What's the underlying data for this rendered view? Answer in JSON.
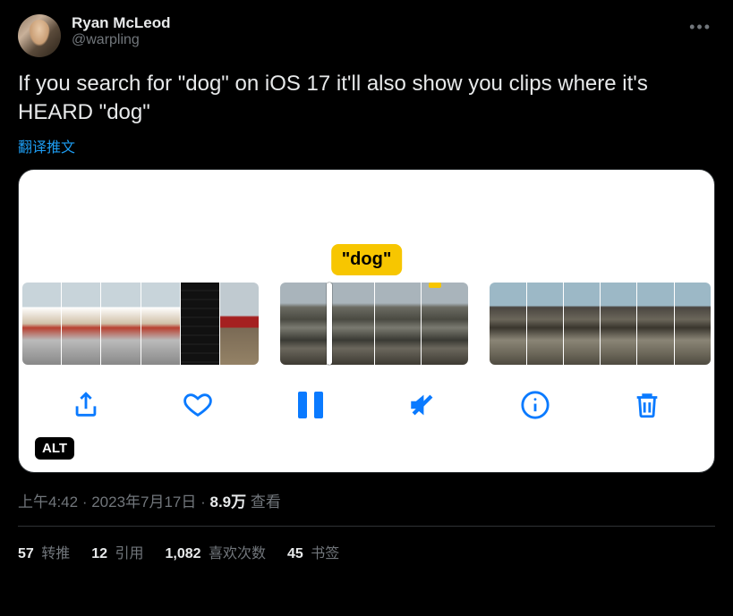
{
  "author": {
    "display_name": "Ryan McLeod",
    "handle": "@warpling"
  },
  "tweet_text": "If you search for \"dog\" on iOS 17 it'll also show you clips where it's HEARD \"dog\"",
  "translate_label": "翻译推文",
  "media": {
    "search_token": "\"dog\"",
    "alt_badge": "ALT",
    "toolbar_icons": {
      "share": "share-icon",
      "like": "heart-icon",
      "pause": "pause-icon",
      "mute": "mute-icon",
      "info": "info-icon",
      "delete": "trash-icon"
    }
  },
  "meta": {
    "time": "上午4:42",
    "sep1": " · ",
    "date": "2023年7月17日",
    "sep2": " · ",
    "views_count": "8.9万",
    "views_label": " 查看"
  },
  "stats": {
    "retweets": {
      "count": "57",
      "label": " 转推"
    },
    "quotes": {
      "count": "12",
      "label": " 引用"
    },
    "likes": {
      "count": "1,082",
      "label": " 喜欢次数"
    },
    "bookmarks": {
      "count": "45",
      "label": " 书签"
    }
  }
}
